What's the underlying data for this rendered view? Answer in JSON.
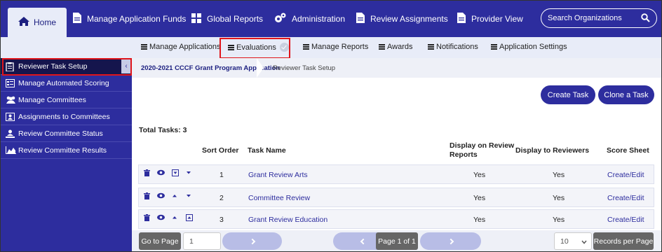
{
  "top_nav": {
    "items": [
      {
        "label": "Home",
        "icon": "home-icon"
      },
      {
        "label": "Manage Application Funds",
        "icon": "document-icon"
      },
      {
        "label": "Global Reports",
        "icon": "grid-icon"
      },
      {
        "label": "Administration",
        "icon": "gears-icon"
      },
      {
        "label": "Review Assignments",
        "icon": "document-icon"
      },
      {
        "label": "Provider View",
        "icon": "document-icon"
      }
    ],
    "search_placeholder": "Search Organizations"
  },
  "sub_nav": {
    "items": [
      "Manage Applications",
      "Evaluations",
      "Manage Reports",
      "Awards",
      "Notifications",
      "Application Settings"
    ]
  },
  "sidebar": {
    "items": [
      {
        "label": "Reviewer Task Setup",
        "icon": "clipboard-icon"
      },
      {
        "label": "Manage Automated Scoring",
        "icon": "scoring-icon"
      },
      {
        "label": "Manage Committees",
        "icon": "people-icon"
      },
      {
        "label": "Assignments to Committees",
        "icon": "assignment-icon"
      },
      {
        "label": "Review Committee Status",
        "icon": "status-icon"
      },
      {
        "label": "Review Committee Results",
        "icon": "chart-icon"
      }
    ],
    "collapse_glyph": "‹"
  },
  "breadcrumb": {
    "program": "2020-2021 CCCF Grant Program Application",
    "page": "Reviewer Task Setup"
  },
  "actions": {
    "create_task": "Create Task",
    "clone_task": "Clone a Task"
  },
  "totals": "Total Tasks: 3",
  "table": {
    "headers": {
      "sort_order": "Sort Order",
      "task_name": "Task Name",
      "display_on_reports": "Display on Review Reports",
      "display_to_reviewers": "Display to Reviewers",
      "score_sheet": "Score Sheet"
    },
    "rows": [
      {
        "sort": "1",
        "name": "Grant Review Arts",
        "reports": "Yes",
        "reviewers": "Yes",
        "score": "Create/Edit"
      },
      {
        "sort": "2",
        "name": "Committee Review",
        "reports": "Yes",
        "reviewers": "Yes",
        "score": "Create/Edit"
      },
      {
        "sort": "3",
        "name": "Grant Review Education",
        "reports": "Yes",
        "reviewers": "Yes",
        "score": "Create/Edit"
      }
    ]
  },
  "pager": {
    "go_to_page": "Go to Page",
    "page_value": "1",
    "page_status": "Page 1 of 1",
    "records_value": "10",
    "records_per_page": "Records per Page"
  },
  "colors": {
    "nav_blue": "#2d2d9e",
    "dark_navy": "#15154d",
    "highlight_red": "#e0151b",
    "link": "#2d2d9e"
  }
}
